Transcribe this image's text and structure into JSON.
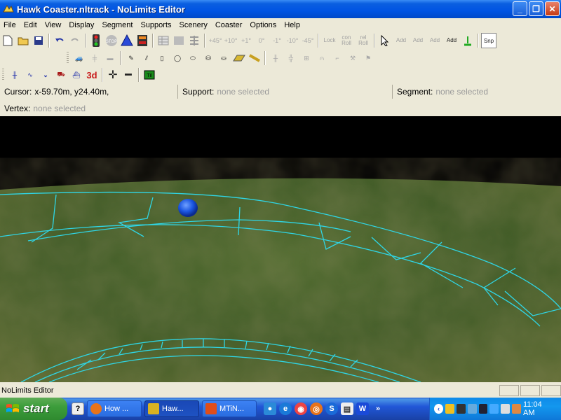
{
  "window": {
    "title": "Hawk Coaster.nltrack - NoLimits Editor",
    "minimize": "_",
    "maximize": "❐",
    "close": "✕"
  },
  "menu": [
    "File",
    "Edit",
    "View",
    "Display",
    "Segment",
    "Supports",
    "Scenery",
    "Coaster",
    "Options",
    "Help"
  ],
  "toolbar": {
    "angles": [
      "+45°",
      "+10°",
      "+1°",
      "0°",
      "-1°",
      "-10°",
      "-45°"
    ],
    "lock_label": "Lock",
    "con_roll": "con\nRoll",
    "rel_roll": "rel\nRoll",
    "add1": "Add",
    "add2": "Add",
    "add3": "Add",
    "add4": "Add",
    "snp": "Snp",
    "threed": "3d"
  },
  "status": {
    "cursor_label": "Cursor:",
    "cursor_value": "x-59.70m, y24.40m,",
    "support_label": "Support:",
    "support_value": "none selected",
    "segment_label": "Segment:",
    "segment_value": "none selected",
    "vertex_label": "Vertex:",
    "vertex_value": "none selected"
  },
  "statusbar": {
    "message": "NoLimits Editor"
  },
  "taskbar": {
    "start": "start",
    "tasks": [
      {
        "label": "How ...",
        "color": "#e8731a"
      },
      {
        "label": "Haw...",
        "color": "#d8b222"
      },
      {
        "label": "MTiN...",
        "color": "#e04d1a"
      }
    ],
    "clock": "11:04 AM"
  },
  "colors": {
    "track_wireframe": "#2fd6e6",
    "sky": "#000000",
    "ground": "#3d5a26",
    "vertex_ball": "#1a55e0"
  }
}
